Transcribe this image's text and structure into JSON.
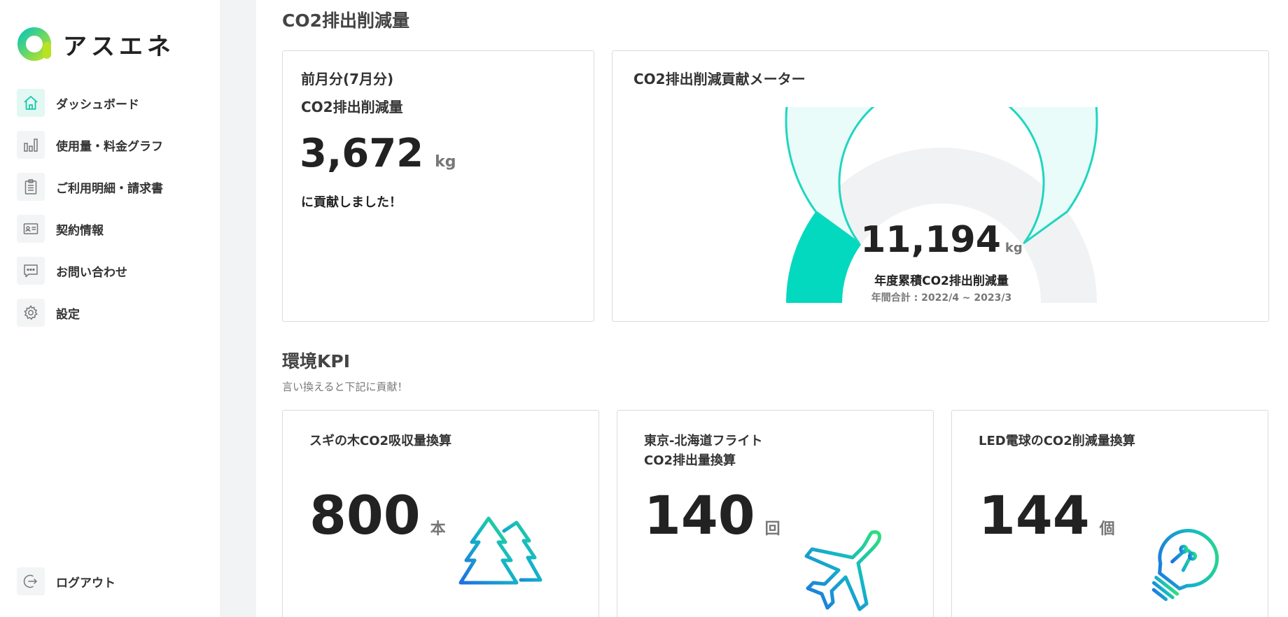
{
  "brand": {
    "name": "アスエネ",
    "accent": "#00d9b8"
  },
  "sidebar": {
    "items": [
      {
        "label": "ダッシュボード",
        "icon": "home-icon",
        "active": true
      },
      {
        "label": "使用量・料金グラフ",
        "icon": "bar-chart-icon"
      },
      {
        "label": "ご利用明細・請求書",
        "icon": "clipboard-icon"
      },
      {
        "label": "契約情報",
        "icon": "id-card-icon"
      },
      {
        "label": "お問い合わせ",
        "icon": "chat-icon"
      },
      {
        "label": "設定",
        "icon": "gear-icon"
      }
    ],
    "logout": {
      "label": "ログアウト",
      "icon": "logout-icon"
    }
  },
  "co2": {
    "section_title": "CO2排出削減量",
    "monthly": {
      "line1": "前月分(7月分)",
      "line2": "CO2排出削減量",
      "value": "3,672",
      "unit": "kg",
      "caption": "に貢献しました！"
    },
    "meter": {
      "title": "CO2排出削減貢献メーター",
      "value": "11,194",
      "unit": "kg",
      "label": "年度累積CO2排出削減量",
      "period": "年間合計 : 2022/4 ~ 2023/3",
      "fill_fraction": 0.2,
      "target_fraction": 0.8
    }
  },
  "kpi": {
    "section_title": "環境KPI",
    "subtitle": "言い換えると下記に貢献！",
    "cards": [
      {
        "title_lines": [
          "スギの木CO2吸収量換算"
        ],
        "value": "800",
        "unit": "本",
        "icon": "tree-icon"
      },
      {
        "title_lines": [
          "東京-北海道フライト",
          "CO2排出量換算"
        ],
        "value": "140",
        "unit": "回",
        "icon": "airplane-icon"
      },
      {
        "title_lines": [
          "LED電球のCO2削減量換算"
        ],
        "value": "144",
        "unit": "個",
        "icon": "lightbulb-icon"
      }
    ]
  }
}
